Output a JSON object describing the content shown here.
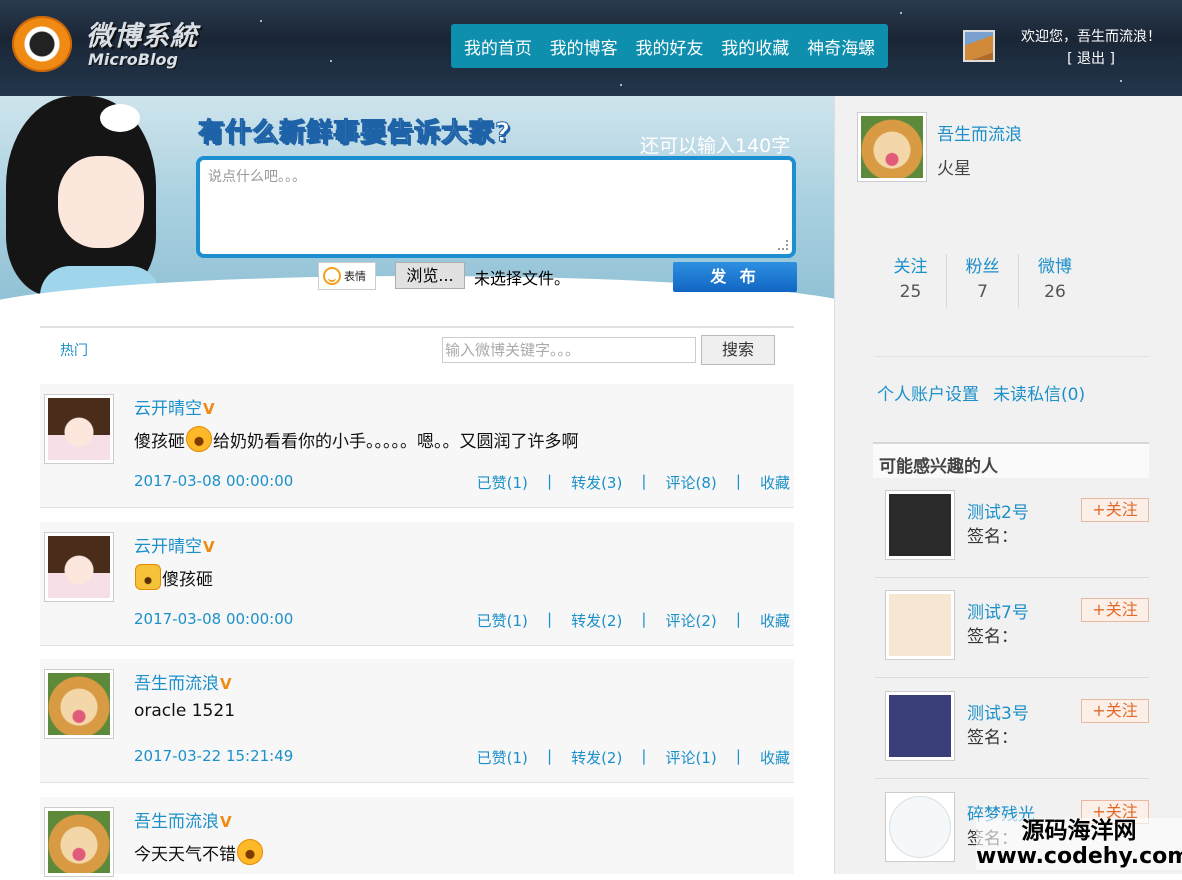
{
  "header": {
    "logo_cn": "微博系統",
    "logo_en": "MicroBlog",
    "nav": [
      "我的首页",
      "我的博客",
      "我的好友",
      "我的收藏",
      "神奇海螺"
    ],
    "welcome": "欢迎您，吾生而流浪！",
    "logout": "[ 退出 ]"
  },
  "composer": {
    "prompt": "有什么新鲜事要告诉大家?",
    "remaining": "还可以输入140字",
    "placeholder": "说点什么吧。。。",
    "emoji_label": "表情",
    "browse_label": "浏览...",
    "no_file": "未选择文件。",
    "publish_label": "发 布"
  },
  "filter": {
    "hot_tab": "热门",
    "search_placeholder": "输入微博关键字。。。",
    "search_label": "搜索"
  },
  "posts": [
    {
      "author": "云开晴空",
      "verified": "V",
      "pre": "傻孩砸",
      "emoji": "shy-face-emoji",
      "post": "给奶奶看看你的小手。。。。。嗯。。又圆润了许多啊",
      "time": "2017-03-08 00:00:00",
      "likes": "已赞(1)",
      "forwards": "转发(3)",
      "comments": "评论(8)",
      "fav": "收藏",
      "avatar": "girl"
    },
    {
      "author": "云开晴空",
      "verified": "V",
      "pre": "",
      "emoji": "doge-emoji",
      "post": "傻孩砸",
      "time": "2017-03-08 00:00:00",
      "likes": "已赞(1)",
      "forwards": "转发(2)",
      "comments": "评论(2)",
      "fav": "收藏",
      "avatar": "girl"
    },
    {
      "author": "吾生而流浪",
      "verified": "V",
      "pre": "",
      "emoji": "",
      "post": "oracle 1521",
      "time": "2017-03-22 15:21:49",
      "likes": "已赞(1)",
      "forwards": "转发(2)",
      "comments": "评论(1)",
      "fav": "收藏",
      "avatar": "dog"
    },
    {
      "author": "吾生而流浪",
      "verified": "V",
      "pre": "今天天气不错",
      "emoji": "laugh-emoji",
      "post": "",
      "time": "",
      "likes": "",
      "forwards": "",
      "comments": "",
      "fav": "",
      "avatar": "dog"
    }
  ],
  "profile": {
    "name": "吾生而流浪",
    "location": "火星",
    "stats": [
      {
        "label": "关注",
        "value": "25"
      },
      {
        "label": "粉丝",
        "value": "7"
      },
      {
        "label": "微博",
        "value": "26"
      }
    ],
    "settings_link": "个人账户设置",
    "messages_link": "未读私信(0)"
  },
  "recommend": {
    "title": "可能感兴趣的人",
    "people": [
      {
        "name": "测试2号",
        "sig": "签名：",
        "follow": "+关注",
        "avatar_color": "#2a2a2a"
      },
      {
        "name": "测试7号",
        "sig": "签名：",
        "follow": "+关注",
        "avatar_color": "#f6e6d2"
      },
      {
        "name": "测试3号",
        "sig": "签名：",
        "follow": "+关注",
        "avatar_color": "#3a3f7a"
      },
      {
        "name": "碎梦残光",
        "sig": "签名：",
        "follow": "+关注",
        "avatar_color": "#f4f8fa"
      }
    ]
  },
  "watermark": {
    "line1": "源码海洋网",
    "line2": "www.codehy.com"
  }
}
